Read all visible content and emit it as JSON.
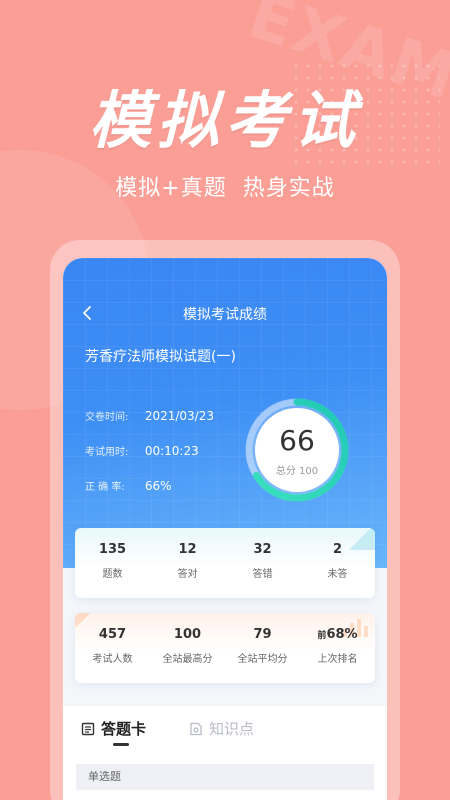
{
  "hero": {
    "title": "模拟考试",
    "subtitle": "模拟+真题  热身实战",
    "bg_word": "EXAM"
  },
  "nav": {
    "back_icon": "chevron-left-icon",
    "title": "模拟考试成绩"
  },
  "paper": {
    "title": "芳香疗法师模拟试题(一)"
  },
  "info": [
    {
      "label": "交卷时间:",
      "value": "2021/03/23"
    },
    {
      "label": "考试用时:",
      "value": "00:10:23"
    },
    {
      "label": "正 确 率:",
      "value": "66%"
    }
  ],
  "score": {
    "value": "66",
    "total_label": "总分 100",
    "fraction": 0.66
  },
  "stats_card_1": [
    {
      "value": "135",
      "label": "题数"
    },
    {
      "value": "12",
      "label": "答对"
    },
    {
      "value": "32",
      "label": "答错"
    },
    {
      "value": "2",
      "label": "未答"
    }
  ],
  "stats_card_2": [
    {
      "value": "457",
      "label": "考试人数"
    },
    {
      "value": "100",
      "label": "全站最高分"
    },
    {
      "value": "79",
      "label": "全站平均分"
    },
    {
      "prefix": "前",
      "value": "68%",
      "label": "上次排名"
    }
  ],
  "tabs": [
    {
      "label": "答题卡",
      "icon": "answer-sheet-icon",
      "active": true
    },
    {
      "label": "知识点",
      "icon": "knowledge-icon",
      "active": false
    }
  ],
  "section": {
    "label": "单选题"
  },
  "colors": {
    "background": "#fa9e96",
    "header_blue": "#3a86f3",
    "ring_green": "#25d6b5"
  }
}
